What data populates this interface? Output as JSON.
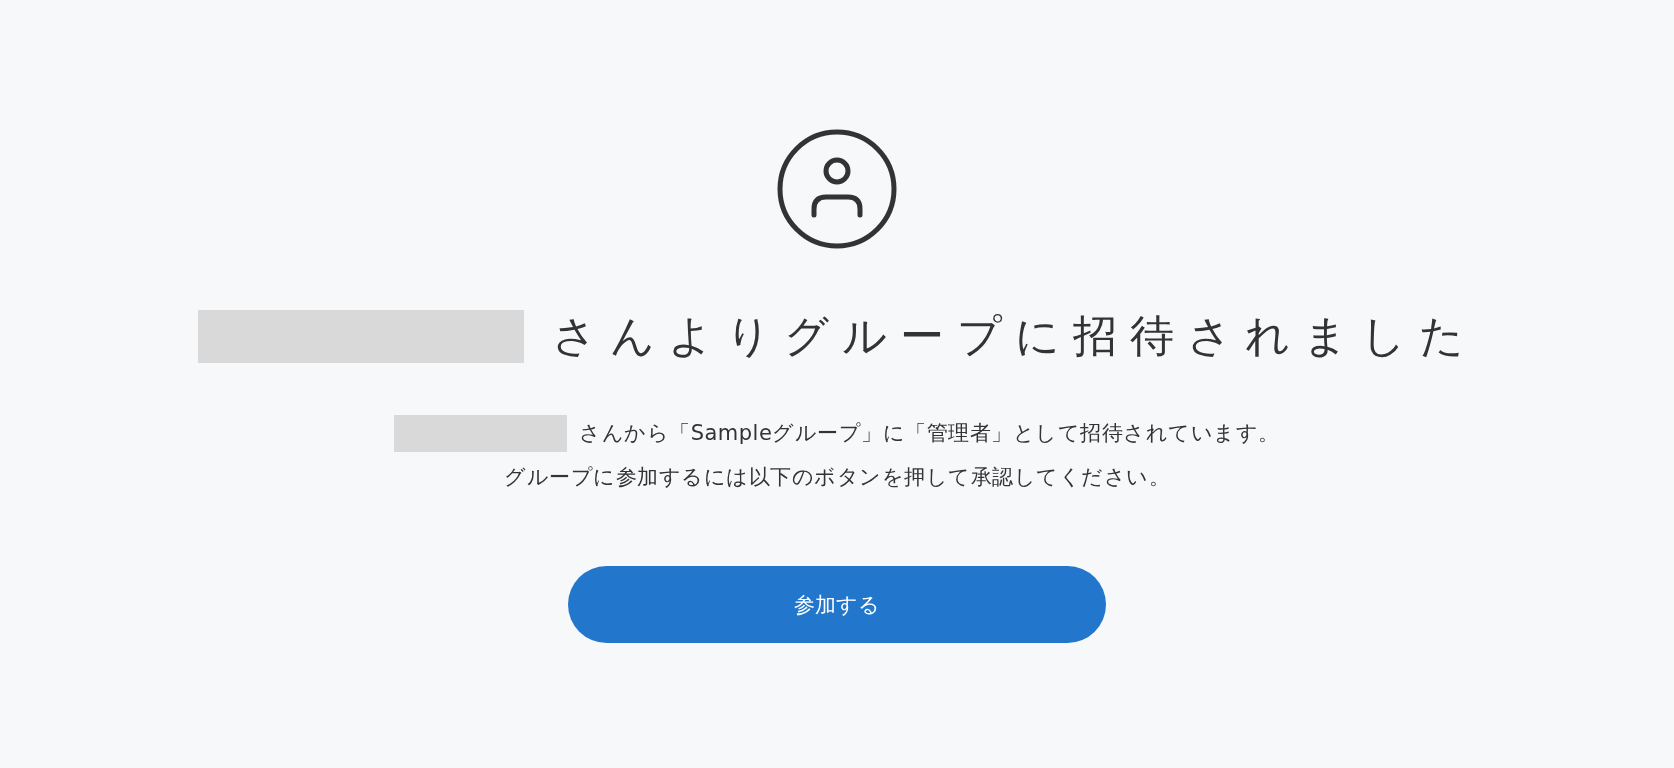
{
  "heading": {
    "text": "さんよりグループに招待されました"
  },
  "message": {
    "line_1": "さんから「Sampleグループ」に「管理者」として招待されています。",
    "line_2": "グループに参加するには以下のボタンを押して承認してください。"
  },
  "button": {
    "label": "参加する"
  }
}
